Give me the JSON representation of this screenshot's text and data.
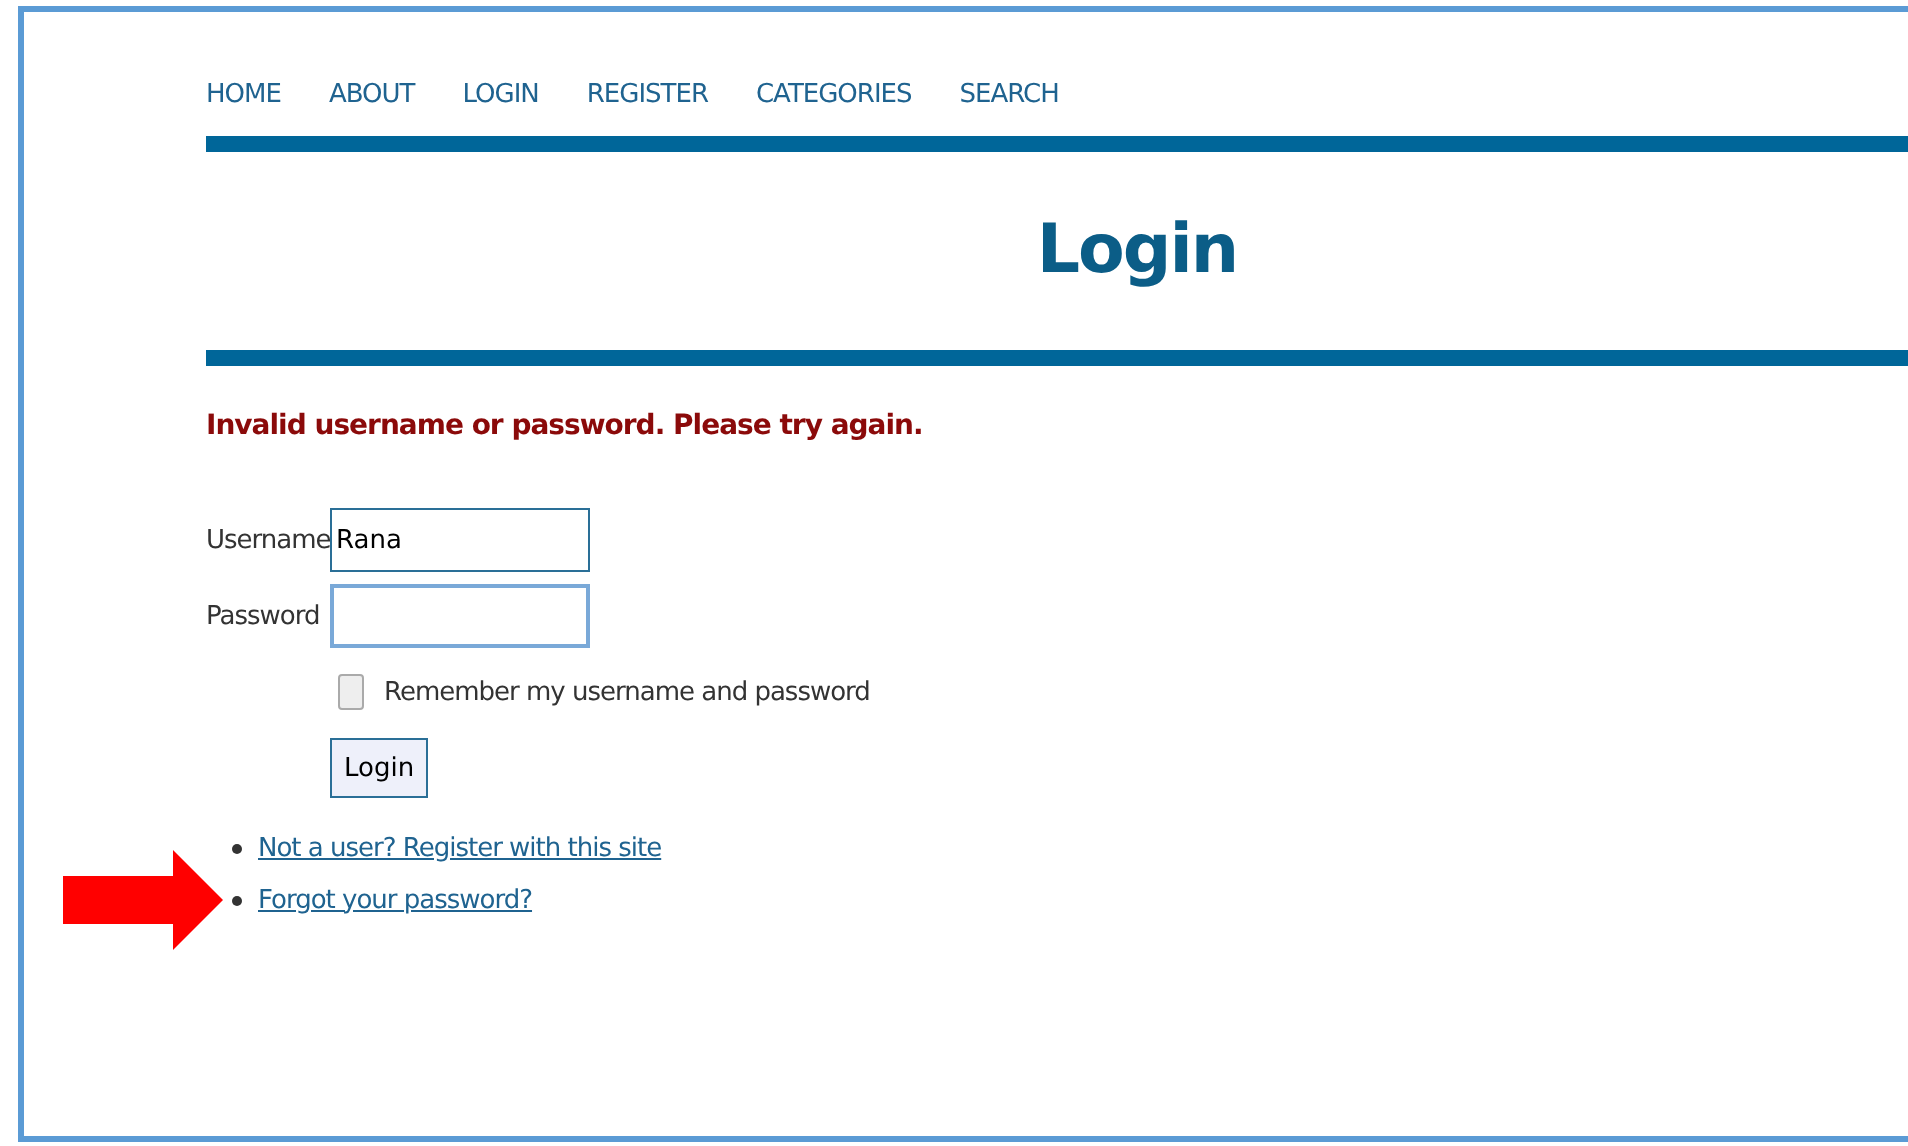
{
  "nav": [
    {
      "label": "HOME"
    },
    {
      "label": "ABOUT"
    },
    {
      "label": "LOGIN"
    },
    {
      "label": "REGISTER"
    },
    {
      "label": "CATEGORIES"
    },
    {
      "label": "SEARCH"
    }
  ],
  "title": "Login",
  "error": "Invalid username or password. Please try again.",
  "form": {
    "username_label": "Username",
    "username_value": "Rana",
    "password_label": "Password",
    "remember": {
      "label": "Remember my username and password",
      "checked": false
    },
    "submit": "Login"
  },
  "links": [
    {
      "label": "Not a user? Register with this site",
      "highlighted": false
    },
    {
      "label": "Forgot your password?",
      "highlighted": true
    }
  ]
}
